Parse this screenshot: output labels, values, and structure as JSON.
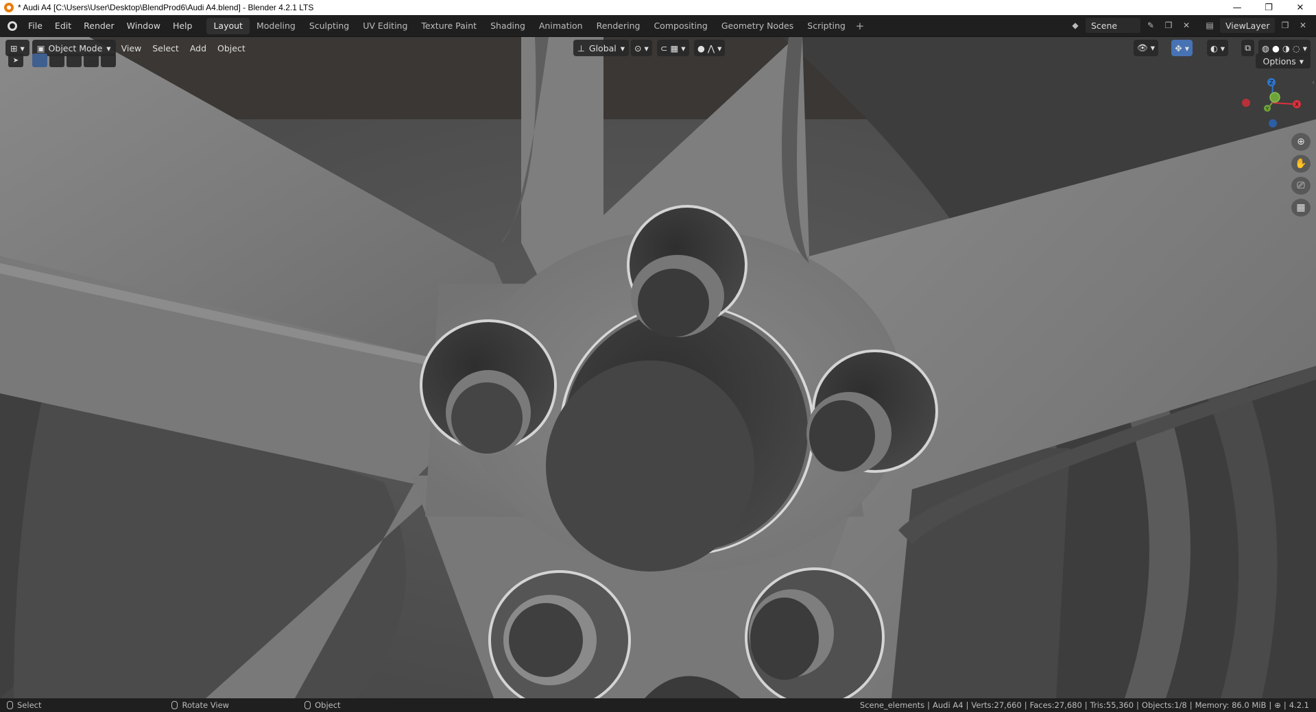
{
  "window": {
    "title": "* Audi A4 [C:\\Users\\User\\Desktop\\BlendProd6\\Audi A4.blend] - Blender 4.2.1 LTS",
    "controls": [
      "—",
      "❐",
      "✕"
    ]
  },
  "menu": [
    "File",
    "Edit",
    "Render",
    "Window",
    "Help"
  ],
  "workspaces": [
    {
      "label": "Layout",
      "active": true
    },
    {
      "label": "Modeling"
    },
    {
      "label": "Sculpting"
    },
    {
      "label": "UV Editing"
    },
    {
      "label": "Texture Paint"
    },
    {
      "label": "Shading"
    },
    {
      "label": "Animation"
    },
    {
      "label": "Rendering"
    },
    {
      "label": "Compositing"
    },
    {
      "label": "Geometry Nodes"
    },
    {
      "label": "Scripting"
    }
  ],
  "scene": {
    "name": "Scene",
    "view_layer": "ViewLayer"
  },
  "viewport_header": {
    "mode": "Object Mode",
    "menus": [
      "View",
      "Select",
      "Add",
      "Object"
    ],
    "transform_orientation": "Global"
  },
  "options_label": "Options",
  "gizmo": {
    "x": "X",
    "y": "Y",
    "z": "Z"
  },
  "statusbar": {
    "left": [
      {
        "label": "Select"
      },
      {
        "label": "Rotate View"
      },
      {
        "label": "Object"
      }
    ],
    "collection": "Scene_elements",
    "object": "Audi A4",
    "verts": "Verts:27,660",
    "faces": "Faces:27,680",
    "tris": "Tris:55,360",
    "objects": "Objects:1/8",
    "memory": "Memory: 86.0 MiB",
    "version": "4.2.1"
  },
  "colors": {
    "accent": "#4772b3",
    "gizmo_x": "#d8323c",
    "gizmo_y": "#6ea33a",
    "gizmo_z": "#2f74c9"
  }
}
